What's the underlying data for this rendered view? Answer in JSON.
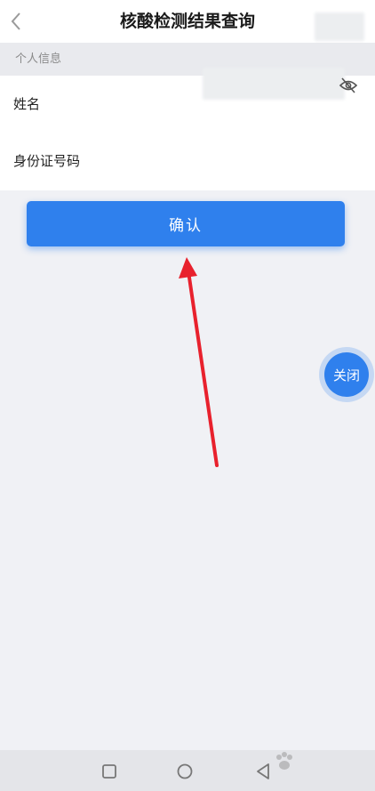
{
  "header": {
    "title": "核酸检测结果查询"
  },
  "section": {
    "label": "个人信息"
  },
  "form": {
    "name_label": "姓名",
    "name_value": "",
    "id_label": "身份证号码",
    "id_value": ""
  },
  "confirm_label": "确认",
  "float_close_label": "关闭",
  "colors": {
    "accent": "#2f80ed",
    "annotation_arrow": "#e8212d",
    "background": "#f0f1f5"
  },
  "icons": {
    "back": "chevron-left-icon",
    "eye_toggle": "eye-off-icon",
    "nav_square": "recent-apps-icon",
    "nav_circle": "home-icon",
    "nav_triangle": "back-triangle-icon"
  }
}
